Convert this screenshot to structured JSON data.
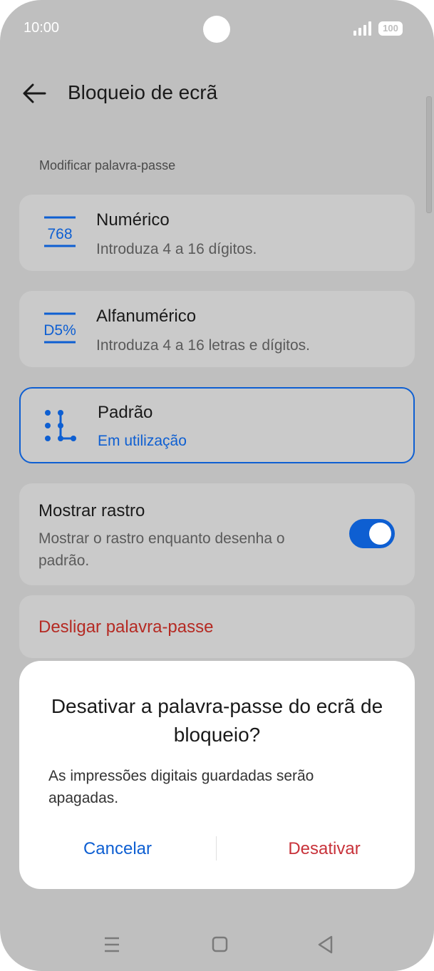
{
  "status_bar": {
    "time": "10:00",
    "battery": "100"
  },
  "header": {
    "title": "Bloqueio de ecrã"
  },
  "section": {
    "label": "Modificar palavra-passe"
  },
  "options": [
    {
      "icon_text": "768",
      "title": "Numérico",
      "subtitle": "Introduza 4 a 16 dígitos."
    },
    {
      "icon_text": "D5%",
      "title": "Alfanumérico",
      "subtitle": "Introduza 4 a 16 letras e dígitos."
    },
    {
      "title": "Padrão",
      "subtitle": "Em utilização"
    }
  ],
  "trail": {
    "title": "Mostrar rastro",
    "description": "Mostrar o rastro enquanto desenha o padrão.",
    "enabled": true
  },
  "disable_password": {
    "label": "Desligar palavra-passe"
  },
  "dialog": {
    "title": "Desativar a palavra-passe do ecrã de bloqueio?",
    "message": "As impressões digitais guardadas serão apagadas.",
    "cancel": "Cancelar",
    "confirm": "Desativar"
  },
  "colors": {
    "accent": "#0e5fd2",
    "danger": "#b52a23",
    "background": "#bfbfbf",
    "card": "#cacaca"
  },
  "nav_bar": {
    "icons": [
      "menu-icon",
      "home-icon",
      "back-triangle-icon"
    ]
  }
}
